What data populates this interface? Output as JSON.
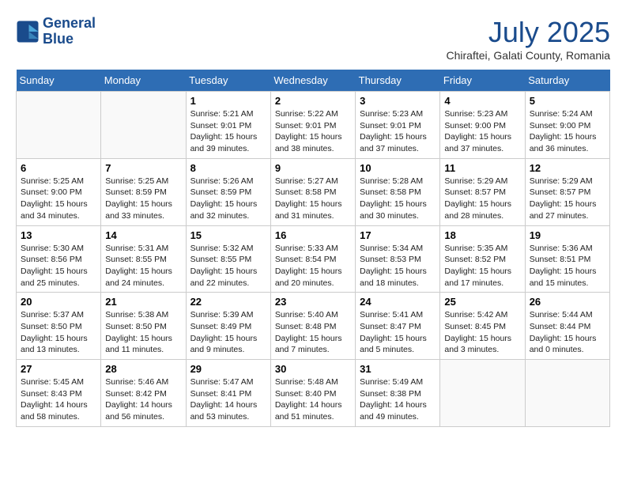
{
  "header": {
    "logo_line1": "General",
    "logo_line2": "Blue",
    "month": "July 2025",
    "location": "Chiraftei, Galati County, Romania"
  },
  "weekdays": [
    "Sunday",
    "Monday",
    "Tuesday",
    "Wednesday",
    "Thursday",
    "Friday",
    "Saturday"
  ],
  "weeks": [
    [
      {
        "day": "",
        "info": ""
      },
      {
        "day": "",
        "info": ""
      },
      {
        "day": "1",
        "sunrise": "5:21 AM",
        "sunset": "9:01 PM",
        "daylight": "15 hours and 39 minutes."
      },
      {
        "day": "2",
        "sunrise": "5:22 AM",
        "sunset": "9:01 PM",
        "daylight": "15 hours and 38 minutes."
      },
      {
        "day": "3",
        "sunrise": "5:23 AM",
        "sunset": "9:01 PM",
        "daylight": "15 hours and 37 minutes."
      },
      {
        "day": "4",
        "sunrise": "5:23 AM",
        "sunset": "9:00 PM",
        "daylight": "15 hours and 37 minutes."
      },
      {
        "day": "5",
        "sunrise": "5:24 AM",
        "sunset": "9:00 PM",
        "daylight": "15 hours and 36 minutes."
      }
    ],
    [
      {
        "day": "6",
        "sunrise": "5:25 AM",
        "sunset": "9:00 PM",
        "daylight": "15 hours and 34 minutes."
      },
      {
        "day": "7",
        "sunrise": "5:25 AM",
        "sunset": "8:59 PM",
        "daylight": "15 hours and 33 minutes."
      },
      {
        "day": "8",
        "sunrise": "5:26 AM",
        "sunset": "8:59 PM",
        "daylight": "15 hours and 32 minutes."
      },
      {
        "day": "9",
        "sunrise": "5:27 AM",
        "sunset": "8:58 PM",
        "daylight": "15 hours and 31 minutes."
      },
      {
        "day": "10",
        "sunrise": "5:28 AM",
        "sunset": "8:58 PM",
        "daylight": "15 hours and 30 minutes."
      },
      {
        "day": "11",
        "sunrise": "5:29 AM",
        "sunset": "8:57 PM",
        "daylight": "15 hours and 28 minutes."
      },
      {
        "day": "12",
        "sunrise": "5:29 AM",
        "sunset": "8:57 PM",
        "daylight": "15 hours and 27 minutes."
      }
    ],
    [
      {
        "day": "13",
        "sunrise": "5:30 AM",
        "sunset": "8:56 PM",
        "daylight": "15 hours and 25 minutes."
      },
      {
        "day": "14",
        "sunrise": "5:31 AM",
        "sunset": "8:55 PM",
        "daylight": "15 hours and 24 minutes."
      },
      {
        "day": "15",
        "sunrise": "5:32 AM",
        "sunset": "8:55 PM",
        "daylight": "15 hours and 22 minutes."
      },
      {
        "day": "16",
        "sunrise": "5:33 AM",
        "sunset": "8:54 PM",
        "daylight": "15 hours and 20 minutes."
      },
      {
        "day": "17",
        "sunrise": "5:34 AM",
        "sunset": "8:53 PM",
        "daylight": "15 hours and 18 minutes."
      },
      {
        "day": "18",
        "sunrise": "5:35 AM",
        "sunset": "8:52 PM",
        "daylight": "15 hours and 17 minutes."
      },
      {
        "day": "19",
        "sunrise": "5:36 AM",
        "sunset": "8:51 PM",
        "daylight": "15 hours and 15 minutes."
      }
    ],
    [
      {
        "day": "20",
        "sunrise": "5:37 AM",
        "sunset": "8:50 PM",
        "daylight": "15 hours and 13 minutes."
      },
      {
        "day": "21",
        "sunrise": "5:38 AM",
        "sunset": "8:50 PM",
        "daylight": "15 hours and 11 minutes."
      },
      {
        "day": "22",
        "sunrise": "5:39 AM",
        "sunset": "8:49 PM",
        "daylight": "15 hours and 9 minutes."
      },
      {
        "day": "23",
        "sunrise": "5:40 AM",
        "sunset": "8:48 PM",
        "daylight": "15 hours and 7 minutes."
      },
      {
        "day": "24",
        "sunrise": "5:41 AM",
        "sunset": "8:47 PM",
        "daylight": "15 hours and 5 minutes."
      },
      {
        "day": "25",
        "sunrise": "5:42 AM",
        "sunset": "8:45 PM",
        "daylight": "15 hours and 3 minutes."
      },
      {
        "day": "26",
        "sunrise": "5:44 AM",
        "sunset": "8:44 PM",
        "daylight": "15 hours and 0 minutes."
      }
    ],
    [
      {
        "day": "27",
        "sunrise": "5:45 AM",
        "sunset": "8:43 PM",
        "daylight": "14 hours and 58 minutes."
      },
      {
        "day": "28",
        "sunrise": "5:46 AM",
        "sunset": "8:42 PM",
        "daylight": "14 hours and 56 minutes."
      },
      {
        "day": "29",
        "sunrise": "5:47 AM",
        "sunset": "8:41 PM",
        "daylight": "14 hours and 53 minutes."
      },
      {
        "day": "30",
        "sunrise": "5:48 AM",
        "sunset": "8:40 PM",
        "daylight": "14 hours and 51 minutes."
      },
      {
        "day": "31",
        "sunrise": "5:49 AM",
        "sunset": "8:38 PM",
        "daylight": "14 hours and 49 minutes."
      },
      {
        "day": "",
        "info": ""
      },
      {
        "day": "",
        "info": ""
      }
    ]
  ]
}
